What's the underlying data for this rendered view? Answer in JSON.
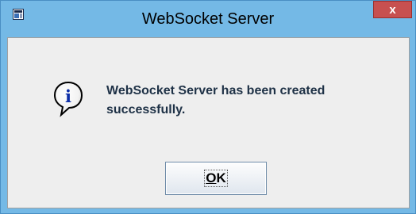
{
  "window": {
    "title": "WebSocket Server",
    "app_icon": "java-app-icon",
    "close_glyph": "x"
  },
  "dialog": {
    "icon": "information-icon",
    "icon_glyph": "i",
    "message": "WebSocket Server has been created successfully.",
    "ok_mnemonic": "O",
    "ok_rest": "K"
  },
  "colors": {
    "frame": "#74b9e6",
    "close_button": "#c75050",
    "message_text": "#1e3146",
    "dialog_background": "#eeeeee"
  }
}
